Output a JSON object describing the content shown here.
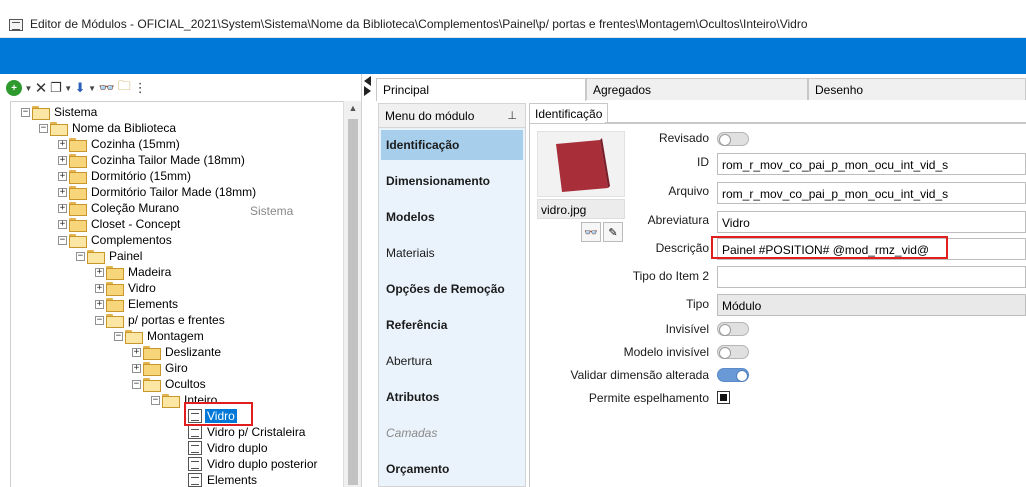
{
  "window": {
    "title": "Editor de Módulos - OFICIAL_2021\\System\\Sistema\\Nome da Biblioteca\\Complementos\\Painel\\p/ portas e frentes\\Montagem\\Ocultos\\Inteiro\\Vidro"
  },
  "tree": {
    "ghost_label": "Sistema",
    "items": [
      {
        "label": "Sistema"
      },
      {
        "label": "Nome da Biblioteca"
      },
      {
        "label": "Cozinha (15mm)"
      },
      {
        "label": "Cozinha Tailor Made (18mm)"
      },
      {
        "label": "Dormitório (15mm)"
      },
      {
        "label": "Dormitório Tailor Made (18mm)"
      },
      {
        "label": "Coleção Murano"
      },
      {
        "label": "Closet - Concept"
      },
      {
        "label": "Complementos"
      },
      {
        "label": "Painel"
      },
      {
        "label": "Madeira"
      },
      {
        "label": "Vidro"
      },
      {
        "label": "Elements"
      },
      {
        "label": "p/ portas e frentes"
      },
      {
        "label": "Montagem"
      },
      {
        "label": "Deslizante"
      },
      {
        "label": "Giro"
      },
      {
        "label": "Ocultos"
      },
      {
        "label": "Inteiro"
      },
      {
        "label": "Vidro"
      },
      {
        "label": "Vidro p/ Cristaleira"
      },
      {
        "label": "Vidro duplo"
      },
      {
        "label": "Vidro duplo posterior"
      },
      {
        "label": "Elements"
      }
    ]
  },
  "tabs": [
    "Principal",
    "Agregados",
    "Desenho"
  ],
  "module_menu": {
    "header": "Menu do módulo",
    "items": [
      "Identificação",
      "Dimensionamento",
      "Modelos",
      "Materiais",
      "Opções de Remoção",
      "Referência",
      "Abertura",
      "Atributos",
      "Camadas",
      "Orçamento"
    ]
  },
  "identificacao": {
    "tab_label": "Identificação",
    "image_name": "vidro.jpg",
    "labels": {
      "revisado": "Revisado",
      "id": "ID",
      "arquivo": "Arquivo",
      "abreviatura": "Abreviatura",
      "descricao": "Descrição",
      "tipo_item2": "Tipo do Item 2",
      "tipo": "Tipo",
      "invisivel": "Invisível",
      "modelo_invisivel": "Modelo invisível",
      "validar": "Validar dimensão alterada",
      "espelhamento": "Permite espelhamento"
    },
    "values": {
      "id": "rom_r_mov_co_pai_p_mon_ocu_int_vid_s",
      "arquivo": "rom_r_mov_co_pai_p_mon_ocu_int_vid_s",
      "abreviatura": "Vidro",
      "descricao": "Painel #POSITION# @mod_rmz_vid@",
      "tipo_item2": "",
      "tipo": "Módulo"
    }
  },
  "colors": {
    "accent": "#0078d7",
    "highlight": "#e01e1e",
    "thumbnail": "#a82e3a"
  }
}
